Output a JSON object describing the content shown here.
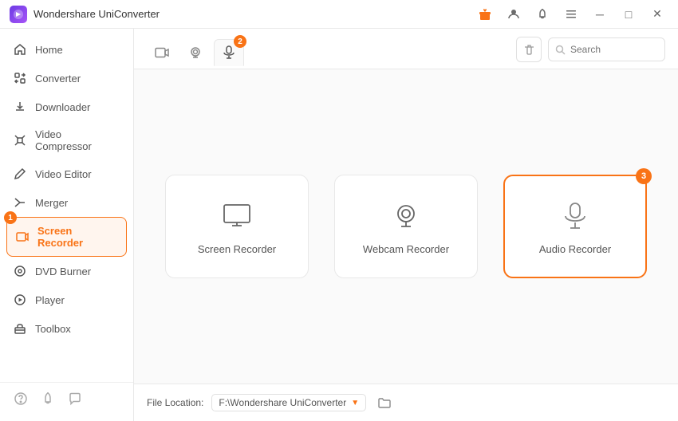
{
  "app": {
    "title": "Wondershare UniConverter",
    "icon_char": "W"
  },
  "titlebar": {
    "icons": [
      "gift-icon",
      "user-icon",
      "bell-icon",
      "menu-icon"
    ],
    "window_buttons": [
      "minimize",
      "maximize",
      "close"
    ]
  },
  "sidebar": {
    "items": [
      {
        "id": "home",
        "label": "Home",
        "icon": "home"
      },
      {
        "id": "converter",
        "label": "Converter",
        "icon": "converter"
      },
      {
        "id": "downloader",
        "label": "Downloader",
        "icon": "downloader"
      },
      {
        "id": "video-compressor",
        "label": "Video Compressor",
        "icon": "compress"
      },
      {
        "id": "video-editor",
        "label": "Video Editor",
        "icon": "edit"
      },
      {
        "id": "merger",
        "label": "Merger",
        "icon": "merge"
      },
      {
        "id": "screen-recorder",
        "label": "Screen Recorder",
        "icon": "record",
        "active": true,
        "badge": "1"
      },
      {
        "id": "dvd-burner",
        "label": "DVD Burner",
        "icon": "dvd"
      },
      {
        "id": "player",
        "label": "Player",
        "icon": "play"
      },
      {
        "id": "toolbox",
        "label": "Toolbox",
        "icon": "toolbox"
      }
    ],
    "bottom_icons": [
      "help-icon",
      "notification-icon",
      "feedback-icon"
    ]
  },
  "tabs": [
    {
      "id": "video-recorder",
      "icon": "video",
      "active": false
    },
    {
      "id": "webcam-recorder",
      "icon": "webcam",
      "active": false
    },
    {
      "id": "audio-recorder",
      "icon": "audio",
      "active": true,
      "badge": "2"
    }
  ],
  "toolbar": {
    "search_placeholder": "Search",
    "delete_label": ""
  },
  "recorder_cards": [
    {
      "id": "screen-recorder",
      "label": "Screen Recorder",
      "icon": "monitor"
    },
    {
      "id": "webcam-recorder",
      "label": "Webcam Recorder",
      "icon": "webcam"
    },
    {
      "id": "audio-recorder",
      "label": "Audio Recorder",
      "icon": "microphone",
      "active": true,
      "badge": "3"
    }
  ],
  "footer": {
    "label": "File Location:",
    "path": "F:\\Wondershare UniConverter",
    "chevron": "▼"
  }
}
